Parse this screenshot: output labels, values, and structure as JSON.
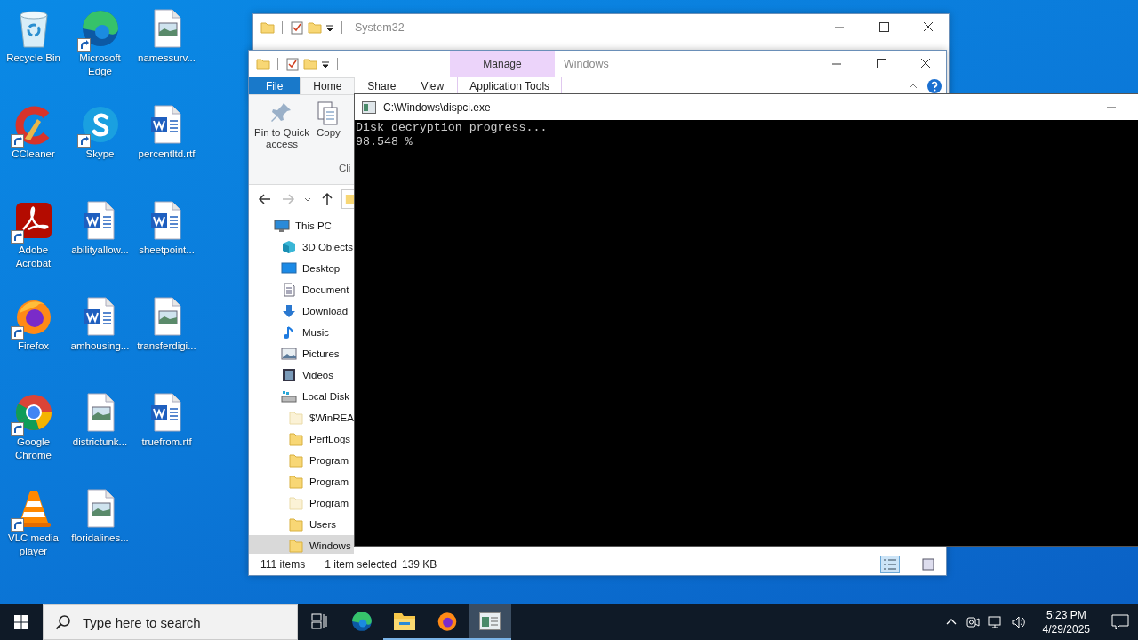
{
  "desktop_icons": [
    {
      "label": "Recycle Bin",
      "kind": "recycle-bin",
      "shortcut": false
    },
    {
      "label": "CCleaner",
      "kind": "ccleaner",
      "shortcut": true
    },
    {
      "label": "Adobe Acrobat",
      "kind": "acrobat",
      "shortcut": true
    },
    {
      "label": "Firefox",
      "kind": "firefox",
      "shortcut": true
    },
    {
      "label": "Google Chrome",
      "kind": "chrome",
      "shortcut": true
    },
    {
      "label": "VLC media player",
      "kind": "vlc",
      "shortcut": true
    },
    {
      "label": "Microsoft Edge",
      "kind": "edge",
      "shortcut": true
    },
    {
      "label": "Skype",
      "kind": "skype",
      "shortcut": true
    },
    {
      "label": "abilityallow...",
      "kind": "word-file",
      "shortcut": false
    },
    {
      "label": "amhousing...",
      "kind": "word-file",
      "shortcut": false
    },
    {
      "label": "districtunk...",
      "kind": "image-file",
      "shortcut": false
    },
    {
      "label": "floridalines...",
      "kind": "image-file",
      "shortcut": false
    },
    {
      "label": "namessurv...",
      "kind": "image-file",
      "shortcut": false
    },
    {
      "label": "percentltd.rtf",
      "kind": "word-file",
      "shortcut": false
    },
    {
      "label": "sheetpoint...",
      "kind": "word-file",
      "shortcut": false
    },
    {
      "label": "transferdigi...",
      "kind": "image-file",
      "shortcut": false
    },
    {
      "label": "truefrom.rtf",
      "kind": "word-file",
      "shortcut": false
    }
  ],
  "back_window": {
    "title": "System32"
  },
  "explorer_window": {
    "title": "Windows",
    "context_tab": {
      "header": "Manage",
      "label": "Application Tools"
    },
    "tabs": [
      {
        "label": "File",
        "kind": "file",
        "selected": false
      },
      {
        "label": "Home",
        "kind": "tab",
        "selected": true
      },
      {
        "label": "Share",
        "kind": "tab",
        "selected": false
      },
      {
        "label": "View",
        "kind": "tab",
        "selected": false
      }
    ],
    "ribbon": {
      "buttons": [
        {
          "label": "Pin to Quick access",
          "kind": "pin"
        },
        {
          "label": "Copy",
          "kind": "copy"
        }
      ],
      "group_label": "Cli"
    },
    "tree": [
      {
        "label": "This PC",
        "kind": "pc",
        "selected": false,
        "children": [
          {
            "label": "3D Objects",
            "kind": "cube",
            "selected": false
          },
          {
            "label": "Desktop",
            "kind": "desktop",
            "selected": false
          },
          {
            "label": "Document",
            "kind": "document",
            "selected": false
          },
          {
            "label": "Download",
            "kind": "download",
            "selected": false
          },
          {
            "label": "Music",
            "kind": "music",
            "selected": false
          },
          {
            "label": "Pictures",
            "kind": "pictures",
            "selected": false
          },
          {
            "label": "Videos",
            "kind": "videos",
            "selected": false
          },
          {
            "label": "Local Disk",
            "kind": "disk",
            "selected": false,
            "children": [
              {
                "label": "$WinREA",
                "kind": "folder",
                "hidden": true,
                "selected": false
              },
              {
                "label": "PerfLogs",
                "kind": "folder",
                "hidden": false,
                "selected": false
              },
              {
                "label": "Program",
                "kind": "folder",
                "hidden": false,
                "selected": false
              },
              {
                "label": "Program",
                "kind": "folder",
                "hidden": false,
                "selected": false
              },
              {
                "label": "Program",
                "kind": "folder",
                "hidden": true,
                "selected": false
              },
              {
                "label": "Users",
                "kind": "folder",
                "hidden": false,
                "selected": false
              },
              {
                "label": "Windows",
                "kind": "folder",
                "hidden": false,
                "selected": true
              }
            ]
          }
        ]
      }
    ],
    "status": {
      "item_count": "111 items",
      "selection": "1 item selected",
      "size": "139 KB"
    }
  },
  "console": {
    "title": "C:\\Windows\\dispci.exe",
    "lines": [
      "Disk decryption progress...",
      "98.548 %"
    ]
  },
  "taskbar": {
    "search_placeholder": "Type here to search",
    "apps": [
      {
        "kind": "task-view",
        "running": false,
        "selected": false
      },
      {
        "kind": "edge",
        "running": false,
        "selected": false
      },
      {
        "kind": "explorer",
        "running": true,
        "selected": false
      },
      {
        "kind": "firefox",
        "running": true,
        "selected": false
      },
      {
        "kind": "console",
        "running": true,
        "selected": true
      }
    ],
    "clock": {
      "time": "5:23 PM",
      "date": "4/29/2025"
    }
  }
}
